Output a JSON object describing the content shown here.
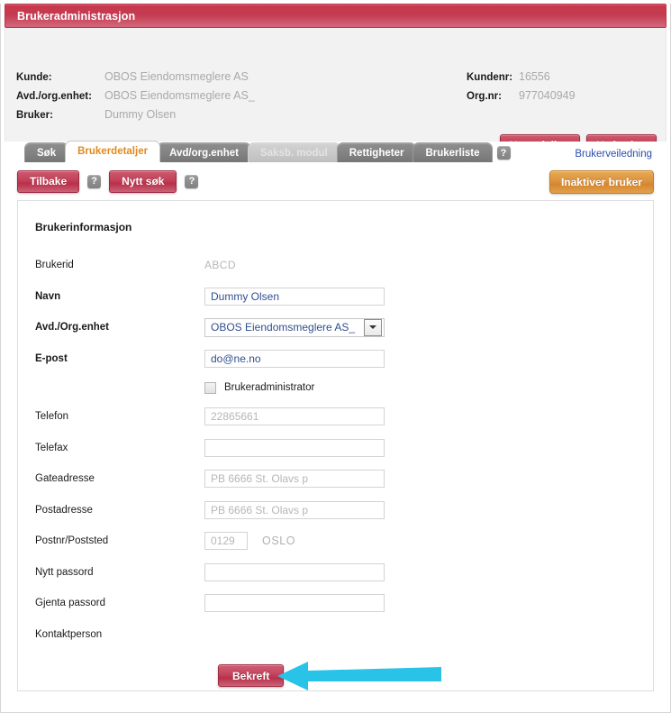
{
  "window": {
    "title": "Brukeradministrasjon"
  },
  "header": {
    "left_rows": [
      {
        "label": "Kunde:",
        "value": "OBOS Eiendomsmeglere AS"
      },
      {
        "label": "Avd./org.enhet:",
        "value": "OBOS Eiendomsmeglere AS_"
      },
      {
        "label": "Bruker:",
        "value": "Dummy Olsen"
      }
    ],
    "right_rows": [
      {
        "label": "Kundenr:",
        "value": "16556"
      },
      {
        "label": "Org.nr:",
        "value": "977040949"
      }
    ],
    "actions": {
      "new_department": "Ny avdeling",
      "new_user": "Ny bruker"
    }
  },
  "tabs": {
    "items": [
      {
        "label": "Søk",
        "state": "normal"
      },
      {
        "label": "Brukerdetaljer",
        "state": "active"
      },
      {
        "label": "Avd/org.enhet",
        "state": "normal"
      },
      {
        "label": "Saksb. modul",
        "state": "disabled"
      },
      {
        "label": "Rettigheter",
        "state": "normal"
      },
      {
        "label": "Brukerliste",
        "state": "normal"
      }
    ],
    "help_badge": "?",
    "guide_link": "Brukerveiledning"
  },
  "toolbar": {
    "back_label": "Tilbake",
    "new_search_label": "Nytt søk",
    "help_badge": "?",
    "deactivate_label": "Inaktiver bruker"
  },
  "form": {
    "section_title": "Brukerinformasjon",
    "rows": [
      {
        "label": "Brukerid",
        "value": "ABCD",
        "kind": "static",
        "bold": false
      },
      {
        "label": "Navn",
        "value": "Dummy Olsen",
        "kind": "input",
        "bold": true,
        "muted": false
      },
      {
        "label": "Avd./Org.enhet",
        "value": "OBOS Eiendomsmeglere AS_",
        "kind": "combo",
        "bold": true
      },
      {
        "label": "E-post",
        "value": "do@ne.no",
        "kind": "input",
        "bold": true,
        "muted": false
      }
    ],
    "checkbox": {
      "label": "Brukeradministrator",
      "checked": false
    },
    "rows2": [
      {
        "label": "Telefon",
        "value": "22865661",
        "kind": "input",
        "bold": false,
        "muted": true
      },
      {
        "label": "Telefax",
        "value": "",
        "kind": "input",
        "bold": false,
        "muted": false
      },
      {
        "label": "Gateadresse",
        "value": "PB 6666 St. Olavs p",
        "kind": "input",
        "bold": false,
        "muted": true
      },
      {
        "label": "Postadresse",
        "value": "PB 6666 St. Olavs p",
        "kind": "input",
        "bold": false,
        "muted": true
      }
    ],
    "zip_row": {
      "label": "Postnr/Poststed",
      "zip": "0129",
      "city": "OSLO"
    },
    "rows3": [
      {
        "label": "Nytt passord",
        "value": "",
        "kind": "input",
        "bold": false,
        "muted": false
      },
      {
        "label": "Gjenta passord",
        "value": "",
        "kind": "input",
        "bold": false,
        "muted": false
      }
    ],
    "contact_label": "Kontaktperson",
    "confirm_label": "Bekreft"
  },
  "annotation": {
    "arrow_color": "#29c3e8",
    "arrow_direction": "left"
  },
  "colors": {
    "title_red": "#c4455c",
    "button_red": "#b9304a",
    "button_orange": "#d4862f",
    "tab_gray": "#828282",
    "active_tab_text": "#e08a1e",
    "link_blue": "#2b4faa",
    "muted_text": "#b6b6b6"
  }
}
